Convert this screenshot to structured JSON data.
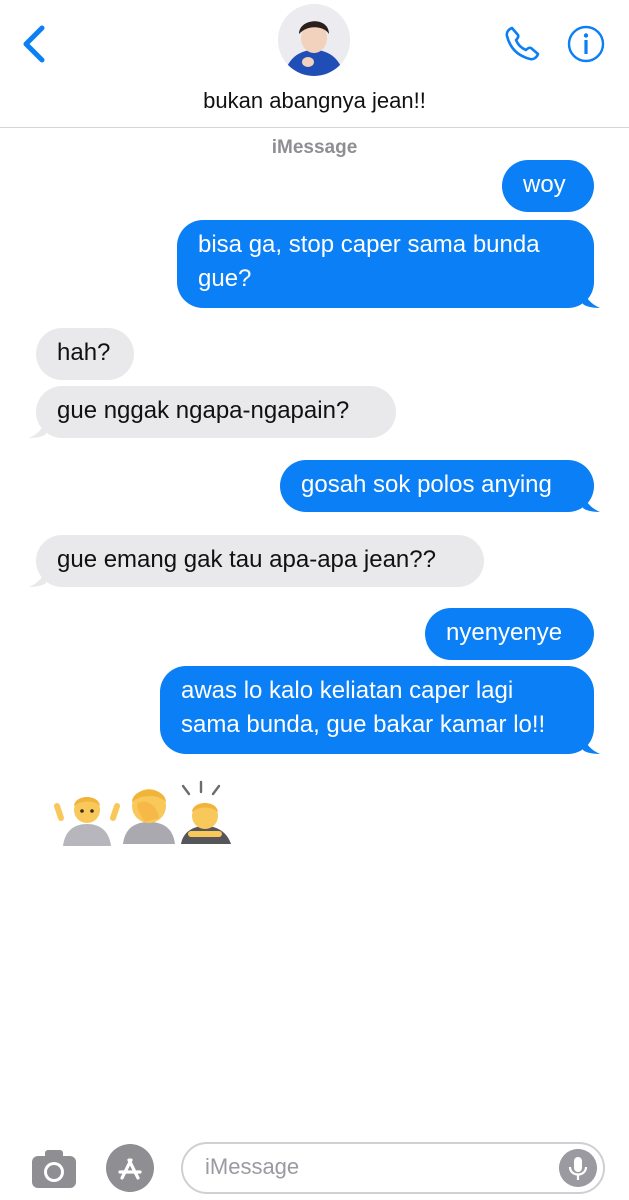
{
  "header": {
    "contact_name": "bukan abangnya jean!!"
  },
  "thread": {
    "service_label": "iMessage",
    "messages": [
      {
        "dir": "out",
        "text": "woy"
      },
      {
        "dir": "out",
        "text": "bisa ga, stop caper sama bunda",
        "text2": "gue?"
      },
      {
        "dir": "in",
        "text": "hah?"
      },
      {
        "dir": "in",
        "text": "gue nggak ngapa-ngapain?"
      },
      {
        "dir": "out",
        "text": "gosah sok polos anying"
      },
      {
        "dir": "in",
        "text": "gue emang gak tau apa-apa jean??"
      },
      {
        "dir": "out",
        "text": "nyenyenye"
      },
      {
        "dir": "out",
        "text": "awas lo kalo keliatan caper lagi",
        "text2": "sama bunda, gue bakar kamar lo!!"
      }
    ],
    "emoji_reply": "🤷‍♂️🤦🙇"
  },
  "composer": {
    "placeholder": "iMessage"
  },
  "colors": {
    "accent": "#0b7ff5",
    "incoming": "#e9e9eb",
    "icon_gray": "#8e8e93"
  }
}
